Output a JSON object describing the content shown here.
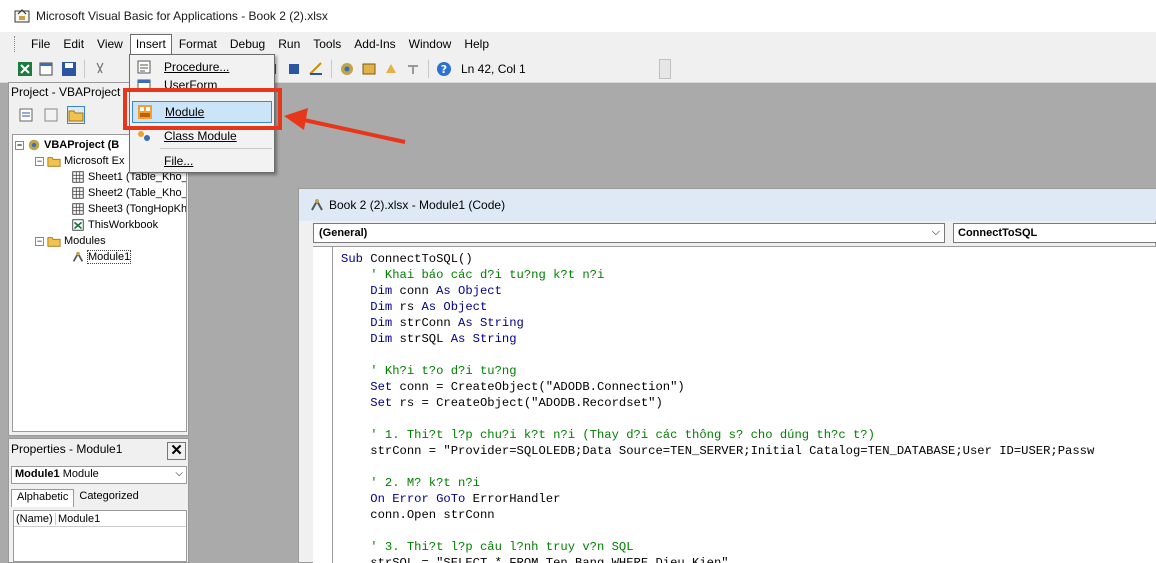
{
  "window": {
    "title": "Microsoft Visual Basic for Applications - Book 2 (2).xlsx"
  },
  "menubar": {
    "items": [
      "File",
      "Edit",
      "View",
      "Insert",
      "Format",
      "Debug",
      "Run",
      "Tools",
      "Add-Ins",
      "Window",
      "Help"
    ]
  },
  "toolbar": {
    "status": "Ln 42, Col 1"
  },
  "project": {
    "title": "Project - VBAProject",
    "tree": [
      {
        "label": "VBAProject (B",
        "bold": true
      },
      {
        "label": "Microsoft Ex"
      },
      {
        "label": "Sheet1 (Table_Kho_"
      },
      {
        "label": "Sheet2 (Table_Kho_"
      },
      {
        "label": "Sheet3 (TongHopKh"
      },
      {
        "label": "ThisWorkbook"
      },
      {
        "label": "Modules"
      },
      {
        "label": "Module1"
      }
    ]
  },
  "properties": {
    "title": "Properties - Module1",
    "close": "✕",
    "object": {
      "name": "Module1",
      "type": "Module"
    },
    "tabs": [
      "Alphabetic",
      "Categorized"
    ],
    "rows": [
      {
        "name": "(Name)",
        "value": "Module1"
      }
    ]
  },
  "insert_menu": {
    "items": [
      "Procedure...",
      "UserForm",
      "Module",
      "Class Module",
      "File..."
    ],
    "highlighted": "Module"
  },
  "code_window": {
    "title": "Book 2 (2).xlsx - Module1 (Code)",
    "object_combo": "(General)",
    "procedure_combo": "ConnectToSQL",
    "lines": [
      [
        {
          "t": "Sub ",
          "c": "kw"
        },
        {
          "t": "ConnectToSQL()",
          "c": "pl"
        }
      ],
      [
        {
          "t": "    ' Khai báo các d?i tu?ng k?t n?i",
          "c": "cm"
        }
      ],
      [
        {
          "t": "    Dim ",
          "c": "kw"
        },
        {
          "t": "conn ",
          "c": "pl"
        },
        {
          "t": "As Object",
          "c": "kw"
        }
      ],
      [
        {
          "t": "    Dim ",
          "c": "kw"
        },
        {
          "t": "rs ",
          "c": "pl"
        },
        {
          "t": "As Object",
          "c": "kw"
        }
      ],
      [
        {
          "t": "    Dim ",
          "c": "kw"
        },
        {
          "t": "strConn ",
          "c": "pl"
        },
        {
          "t": "As String",
          "c": "kw"
        }
      ],
      [
        {
          "t": "    Dim ",
          "c": "kw"
        },
        {
          "t": "strSQL ",
          "c": "pl"
        },
        {
          "t": "As String",
          "c": "kw"
        }
      ],
      [],
      [
        {
          "t": "    ' Kh?i t?o d?i tu?ng",
          "c": "cm"
        }
      ],
      [
        {
          "t": "    Set ",
          "c": "kw"
        },
        {
          "t": "conn = CreateObject(\"ADODB.Connection\")",
          "c": "pl"
        }
      ],
      [
        {
          "t": "    Set ",
          "c": "kw"
        },
        {
          "t": "rs = CreateObject(\"ADODB.Recordset\")",
          "c": "pl"
        }
      ],
      [],
      [
        {
          "t": "    ' 1. Thi?t l?p chu?i k?t n?i (Thay d?i các thông s? cho dúng th?c t?)",
          "c": "cm"
        }
      ],
      [
        {
          "t": "    strConn = \"Provider=SQLOLEDB;Data Source=TEN_SERVER;Initial Catalog=TEN_DATABASE;User ID=USER;Passw",
          "c": "pl"
        }
      ],
      [],
      [
        {
          "t": "    ' 2. M? k?t n?i",
          "c": "cm"
        }
      ],
      [
        {
          "t": "    On Error GoTo ",
          "c": "kw"
        },
        {
          "t": "ErrorHandler",
          "c": "pl"
        }
      ],
      [
        {
          "t": "    conn.Open strConn",
          "c": "pl"
        }
      ],
      [],
      [
        {
          "t": "    ' 3. Thi?t l?p câu l?nh truy v?n SQL",
          "c": "cm"
        }
      ],
      [
        {
          "t": "    strSQL = \"SELECT * FROM Ten_Bang WHERE Dieu_Kien\"",
          "c": "pl"
        }
      ]
    ]
  },
  "colors": {
    "annotation": "#e8361a",
    "keyword": "#00008b",
    "comment": "#008000",
    "menu_highlight": "#cce4f7"
  }
}
